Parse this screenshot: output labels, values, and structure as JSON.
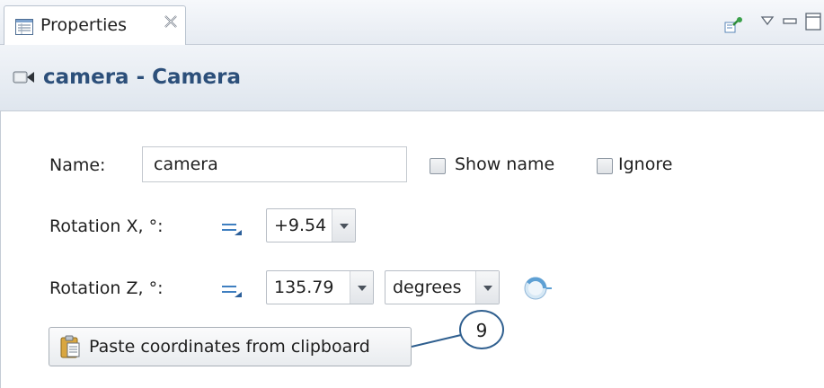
{
  "tab": {
    "label": "Properties",
    "icon": "properties-icon",
    "close_icon": "close-icon"
  },
  "toolbar": {
    "icons": [
      "pin-icon",
      "view-menu-icon",
      "minimize-icon",
      "maximize-icon"
    ]
  },
  "header": {
    "title": "camera - Camera",
    "icon": "camera-icon"
  },
  "form": {
    "name_label": "Name:",
    "name_value": "camera",
    "show_name_label": "Show name",
    "ignore_label": "Ignore",
    "rotation_x_label": "Rotation X, °:",
    "rotation_x_value": "+9.54",
    "rotation_z_label": "Rotation Z, °:",
    "rotation_z_value": "135.79",
    "unit_value": "degrees",
    "paste_button_label": "Paste coordinates from clipboard"
  },
  "callout": {
    "number": "9"
  },
  "colors": {
    "accent": "#2c4f7a",
    "header_bg": "#dfe6ee",
    "callout_line": "#2f5f8f"
  }
}
